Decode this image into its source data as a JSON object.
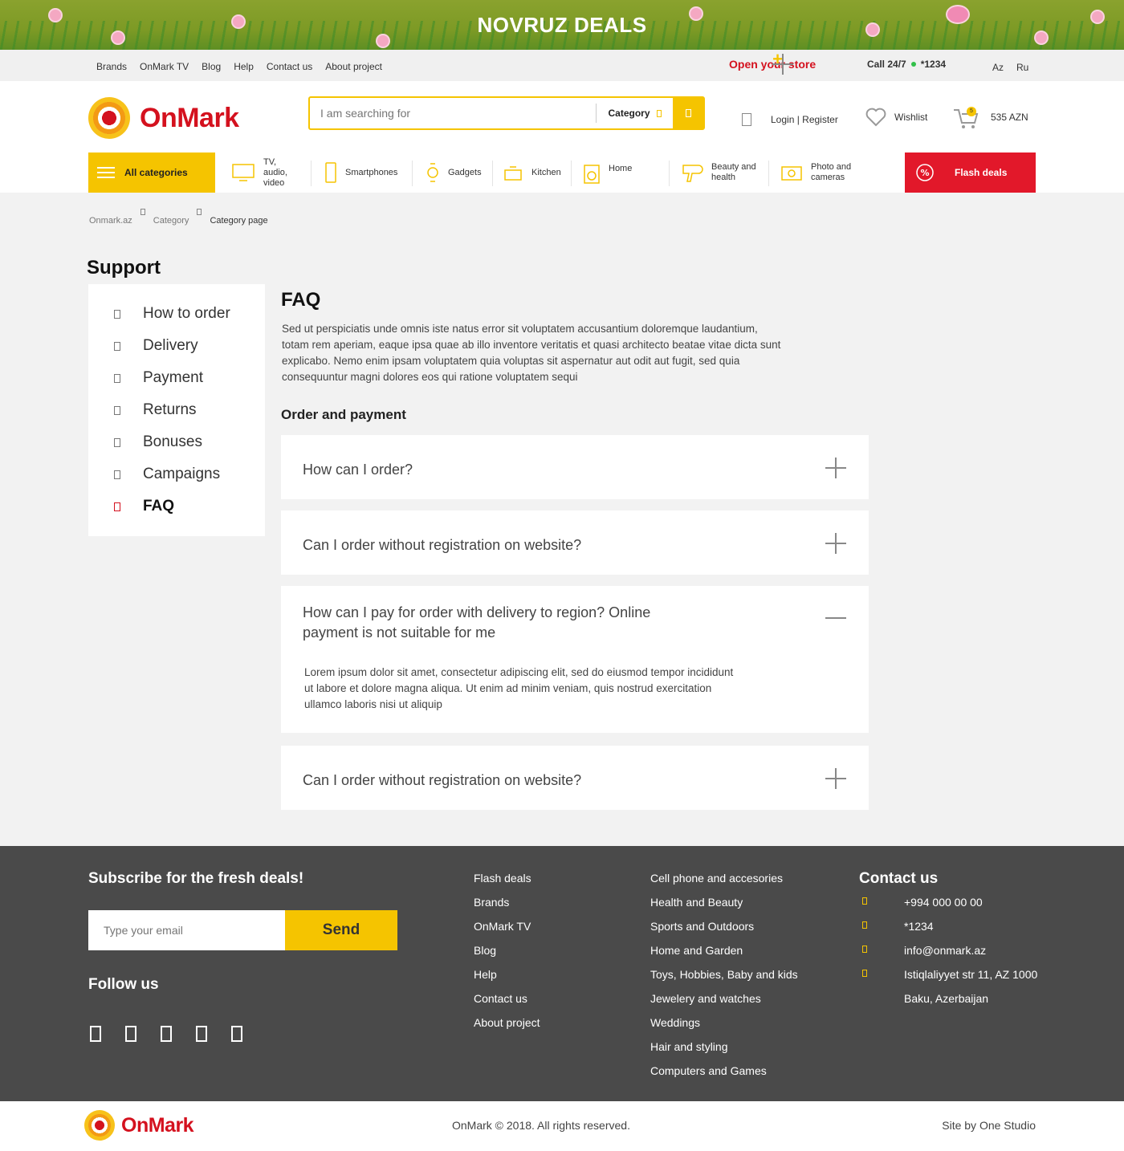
{
  "banner": {
    "title": "NOVRUZ DEALS"
  },
  "topbar": {
    "links": [
      "Brands",
      "OnMark TV",
      "Blog",
      "Help",
      "Contact us",
      "About project"
    ],
    "open_store": "Open your store",
    "call_label": "Call 24/7",
    "call_number": "*1234",
    "langs": [
      "Az",
      "Ru"
    ]
  },
  "header": {
    "logo": "OnMark",
    "search_placeholder": "I am searching for",
    "category_label": "Category",
    "login": "Login | Register",
    "wishlist": "Wishlist",
    "cart_count": "5",
    "cart_total": "535 AZN"
  },
  "catnav": {
    "all_categories": "All categories",
    "items": [
      {
        "label": "TV, audio, video",
        "icon": "tv-icon"
      },
      {
        "label": "Smartphones",
        "icon": "smartphone-icon"
      },
      {
        "label": "Gadgets",
        "icon": "watch-icon"
      },
      {
        "label": "Kitchen",
        "icon": "pot-icon"
      },
      {
        "label": "Home",
        "icon": "washing-machine-icon"
      },
      {
        "label": "Beauty and health",
        "icon": "hairdryer-icon"
      },
      {
        "label": "Photo and cameras",
        "icon": "camera-icon"
      }
    ],
    "flash_deals": "Flash deals"
  },
  "breadcrumb": [
    "Onmark.az",
    "Category",
    "Category page"
  ],
  "support": {
    "title": "Support",
    "items": [
      "How to order",
      "Delivery",
      "Payment",
      "Returns",
      "Bonuses",
      "Campaigns",
      "FAQ"
    ],
    "active": "FAQ"
  },
  "faq": {
    "title": "FAQ",
    "intro": "Sed ut perspiciatis unde omnis iste natus error sit voluptatem accusantium doloremque laudantium, totam rem aperiam, eaque ipsa quae ab illo inventore veritatis et quasi architecto beatae vitae dicta sunt explicabo. Nemo enim ipsam voluptatem quia voluptas sit aspernatur aut odit aut fugit, sed quia consequuntur magni dolores eos qui ratione voluptatem sequi",
    "section": "Order and payment",
    "questions": [
      {
        "q": "How can I order?",
        "open": false
      },
      {
        "q": "Can I order without registration on website?",
        "open": false
      },
      {
        "q": "How can I pay for order with delivery to region? Online payment is not suitable for me",
        "open": true,
        "a": "Lorem ipsum dolor sit amet, consectetur adipiscing elit, sed do eiusmod tempor incididunt ut labore et dolore magna aliqua. Ut enim ad minim veniam, quis nostrud exercitation ullamco laboris nisi ut aliquip"
      },
      {
        "q": "Can I order without registration on website?",
        "open": false
      }
    ]
  },
  "footer": {
    "subscribe_title": "Subscribe for the fresh deals!",
    "email_placeholder": "Type your email",
    "send": "Send",
    "follow": "Follow us",
    "col1": [
      "Flash deals",
      "Brands",
      "OnMark TV",
      "Blog",
      "Help",
      "Contact us",
      "About project"
    ],
    "col2": [
      "Cell phone and accesories",
      "Health and Beauty",
      "Sports and Outdoors",
      "Home and Garden",
      "Toys, Hobbies, Baby and kids",
      "Jewelery and watches",
      "Weddings",
      "Hair and styling",
      "Computers and Games"
    ],
    "contact_title": "Contact us",
    "contacts": [
      "+994 000 00 00",
      "*1234",
      "info@onmark.az",
      "Istiqlaliyyet str 11, AZ 1000",
      "Baku, Azerbaijan"
    ]
  },
  "bottom": {
    "logo": "OnMark",
    "copyright": "OnMark © 2018. All rights reserved.",
    "site_by": "Site by One Studio"
  }
}
